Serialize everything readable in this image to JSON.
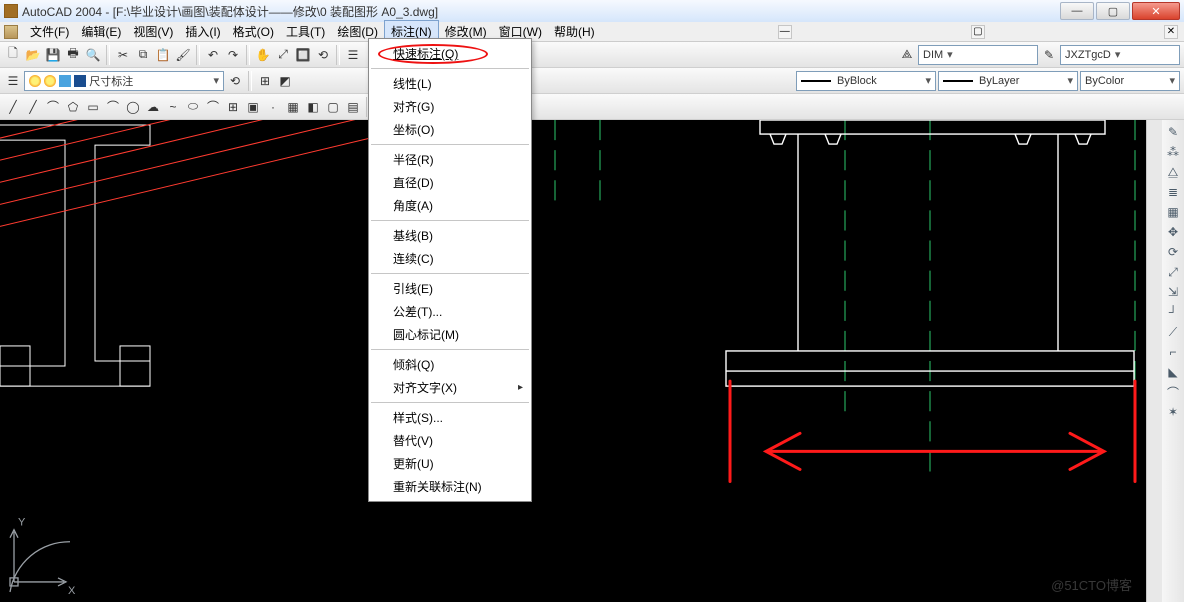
{
  "title": "AutoCAD 2004 - [F:\\毕业设计\\画图\\装配体设计——修改\\0 装配图形 A0_3.dwg]",
  "menubar": {
    "items": [
      "文件(F)",
      "编辑(E)",
      "视图(V)",
      "插入(I)",
      "格式(O)",
      "工具(T)",
      "绘图(D)",
      "标注(N)",
      "修改(M)",
      "窗口(W)",
      "帮助(H)"
    ],
    "open_index": 7,
    "close_glyph": "✕"
  },
  "winbuttons": {
    "min": "—",
    "max": "▢",
    "close": "✕"
  },
  "combos": {
    "dim": "DIM",
    "style": "JXZTgcD",
    "layer": "尺寸标注",
    "byblock": "ByBlock",
    "bylayer": "ByLayer",
    "bycolor": "ByColor",
    "drop_glyph": "▾"
  },
  "dropdown": {
    "groups": [
      {
        "items": [
          {
            "label": "快速标注(Q)",
            "hot": true
          }
        ]
      },
      {
        "items": [
          {
            "label": "线性(L)"
          },
          {
            "label": "对齐(G)"
          },
          {
            "label": "坐标(O)"
          }
        ]
      },
      {
        "items": [
          {
            "label": "半径(R)"
          },
          {
            "label": "直径(D)"
          },
          {
            "label": "角度(A)"
          }
        ]
      },
      {
        "items": [
          {
            "label": "基线(B)"
          },
          {
            "label": "连续(C)"
          }
        ]
      },
      {
        "items": [
          {
            "label": "引线(E)"
          },
          {
            "label": "公差(T)..."
          },
          {
            "label": "圆心标记(M)"
          }
        ]
      },
      {
        "items": [
          {
            "label": "倾斜(Q)"
          },
          {
            "label": "对齐文字(X)",
            "sub": true
          }
        ]
      },
      {
        "items": [
          {
            "label": "样式(S)..."
          },
          {
            "label": "替代(V)"
          },
          {
            "label": "更新(U)"
          },
          {
            "label": "重新关联标注(N)"
          }
        ]
      }
    ]
  },
  "right_icons": [
    "✎",
    "⊕",
    "⌂",
    "≡",
    "⊞",
    "⊕",
    "⟲",
    "?",
    "┘",
    "⟋",
    "⌐",
    "⌒",
    "⌢",
    "□",
    "⚲"
  ],
  "drawrow_icons": [
    "╱",
    "╱",
    "⌒",
    "—",
    "⬠",
    "◻",
    "⌒",
    "☁",
    "⌒",
    "◯",
    "⬭",
    "⌒",
    "~",
    "·",
    "▭",
    "◻",
    "▦",
    "■",
    "□",
    "A"
  ],
  "toolrow1_icons": [
    "▥",
    "▣",
    "☰",
    "⌕",
    "⌫",
    "↶",
    "↷",
    "✎"
  ],
  "layer_icons": [
    "⊞",
    "⟳",
    "⟲"
  ],
  "watermark": "@51CTO博客"
}
